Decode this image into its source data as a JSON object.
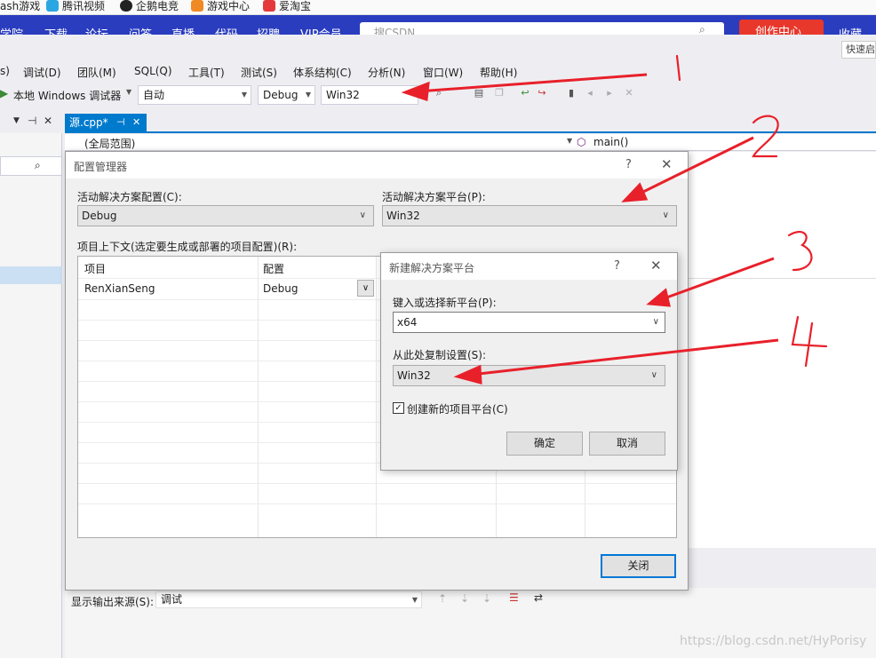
{
  "bookmarks": [
    {
      "label": "ash游戏",
      "color": "#ffffff"
    },
    {
      "label": "腾讯视频",
      "color": "#2aa7e3"
    },
    {
      "label": "企鹅电竞",
      "color": "#222222"
    },
    {
      "label": "游戏中心",
      "color": "#f08a24"
    },
    {
      "label": "爱淘宝",
      "color": "#e4393c"
    }
  ],
  "csdn_nav": [
    "学院",
    "下载",
    "论坛",
    "问答",
    "直播",
    "代码",
    "招聘",
    "VIP会员"
  ],
  "csdn_search_placeholder": "搜CSDN",
  "csdn_create": "创作中心",
  "csdn_collect": "收藏",
  "quick_launch": "快速启",
  "vs_menu": [
    "调试(D)",
    "团队(M)",
    "SQL(Q)",
    "工具(T)",
    "测试(S)",
    "体系结构(C)",
    "分析(N)",
    "窗口(W)",
    "帮助(H)"
  ],
  "toolbar": {
    "debugger": "本地 Windows 调试器",
    "auto": "自动",
    "config": "Debug",
    "platform": "Win32"
  },
  "tab": {
    "label": "源.cpp*",
    "pin": "⊣",
    "close": "✕"
  },
  "navbar": {
    "scope": "(全局范围)",
    "func": "main()"
  },
  "config_manager": {
    "title": "配置管理器",
    "help": "?",
    "active_config_label": "活动解决方案配置(C):",
    "active_config_value": "Debug",
    "active_platform_label": "活动解决方案平台(P):",
    "active_platform_value": "Win32",
    "context_label": "项目上下文(选定要生成或部署的项目配置)(R):",
    "col_project": "项目",
    "col_config": "配置",
    "rows": [
      {
        "project": "RenXianSeng",
        "config": "Debug"
      }
    ],
    "close_button": "关闭"
  },
  "new_platform": {
    "title": "新建解决方案平台",
    "help": "?",
    "type_label": "键入或选择新平台(P):",
    "type_value": "x64",
    "copy_label": "从此处复制设置(S):",
    "copy_value": "Win32",
    "create_check_label": "创建新的项目平台(C)",
    "create_checked": true,
    "ok": "确定",
    "cancel": "取消"
  },
  "output": {
    "label": "显示输出来源(S):",
    "value": "调试"
  },
  "annotations": [
    "1",
    "2",
    "3",
    "4"
  ],
  "watermark": "https://blog.csdn.net/HyPorisy",
  "colors": {
    "vs_blue": "#007acc",
    "csdn_bar": "#2a3dbf",
    "arrow_red": "#e8202a"
  }
}
